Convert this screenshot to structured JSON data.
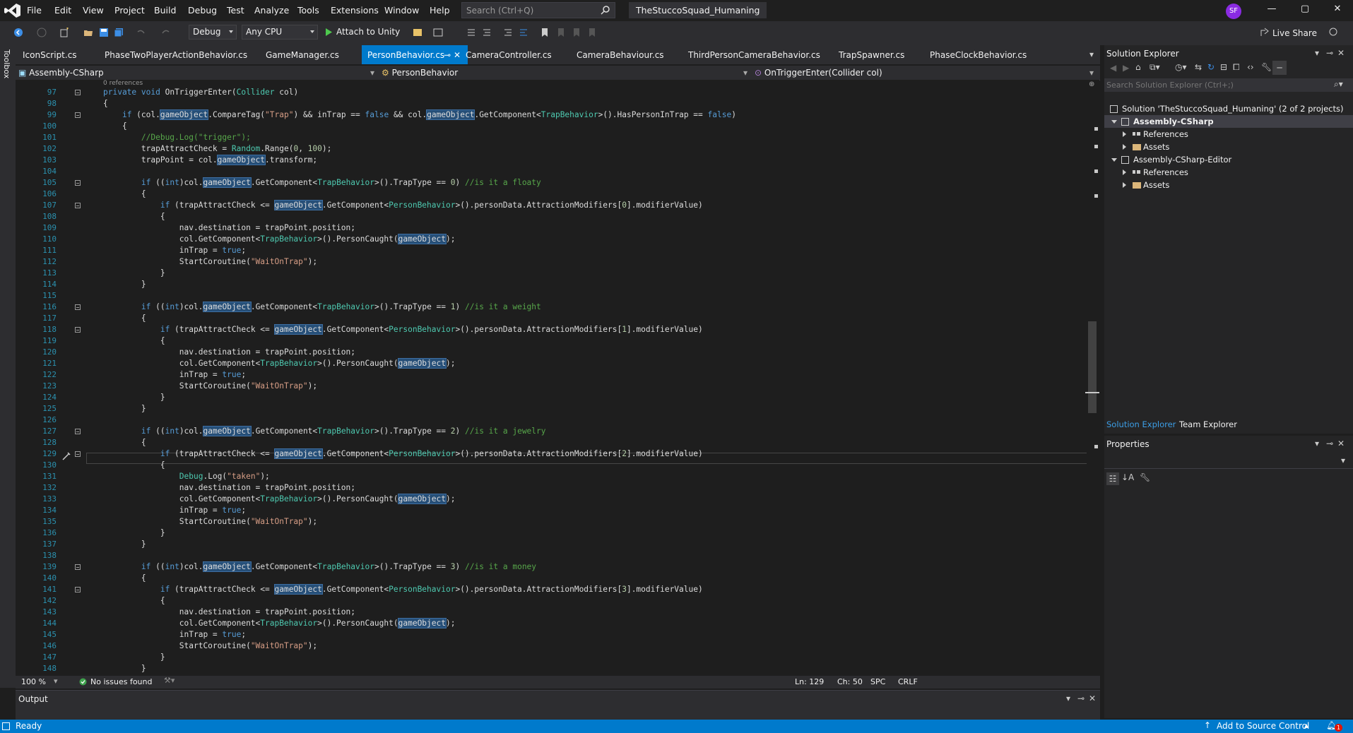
{
  "window": {
    "menu": [
      "File",
      "Edit",
      "View",
      "Project",
      "Build",
      "Debug",
      "Test",
      "Analyze",
      "Tools",
      "Extensions",
      "Window",
      "Help"
    ],
    "search_placeholder": "Search (Ctrl+Q)",
    "solution_name": "TheStuccoSquad_Humaning",
    "user_initials": "SF",
    "minimize": "—",
    "restore": "▢",
    "close": "✕"
  },
  "toolbar": {
    "config": "Debug",
    "platform": "Any CPU",
    "attach": "Attach to Unity",
    "live_share": "Live Share"
  },
  "toolbox_label": "Toolbox",
  "tabs": [
    {
      "label": "IconScript.cs"
    },
    {
      "label": "PhaseTwoPlayerActionBehavior.cs"
    },
    {
      "label": "GameManager.cs"
    },
    {
      "label": "PersonBehavior.cs",
      "active": true
    },
    {
      "label": "CameraController.cs"
    },
    {
      "label": "CameraBehaviour.cs"
    },
    {
      "label": "ThirdPersonCameraBehavior.cs"
    },
    {
      "label": "TrapSpawner.cs"
    },
    {
      "label": "PhaseClockBehavior.cs"
    }
  ],
  "navbar": {
    "project": "Assembly-CSharp",
    "class": "PersonBehavior",
    "member": "OnTriggerEnter(Collider col)"
  },
  "editor": {
    "references_hint": "0 references",
    "line_numbers": [
      "97",
      "98",
      "99",
      "100",
      "101",
      "102",
      "103",
      "104",
      "105",
      "106",
      "107",
      "108",
      "109",
      "110",
      "111",
      "112",
      "113",
      "114",
      "115",
      "116",
      "117",
      "118",
      "119",
      "120",
      "121",
      "122",
      "123",
      "124",
      "125",
      "126",
      "127",
      "128",
      "129",
      "130",
      "131",
      "132",
      "133",
      "134",
      "135",
      "136",
      "137",
      "138",
      "139",
      "140",
      "141",
      "142",
      "143",
      "144",
      "145",
      "146",
      "147",
      "148"
    ],
    "current_line": "129"
  },
  "status_row": {
    "zoom": "100 %",
    "issues": "No issues found",
    "line": "Ln: 129",
    "col": "Ch: 50",
    "spc": "SPC",
    "eol": "CRLF"
  },
  "output": {
    "title": "Output"
  },
  "statusbar": {
    "ready": "Ready",
    "source_control": "Add to Source Control",
    "notifications": "1"
  },
  "solution_explorer": {
    "title": "Solution Explorer",
    "search_placeholder": "Search Solution Explorer (Ctrl+;)",
    "solution": "Solution 'TheStuccoSquad_Humaning' (2 of 2 projects)",
    "project1": "Assembly-CSharp",
    "refs": "References",
    "assets": "Assets",
    "project2": "Assembly-CSharp-Editor",
    "tab_solution": "Solution Explorer",
    "tab_team": "Team Explorer"
  },
  "properties": {
    "title": "Properties"
  },
  "colors": {
    "accent": "#007acc",
    "editor_bg": "#1e1e1e",
    "chrome": "#2d2d30"
  }
}
